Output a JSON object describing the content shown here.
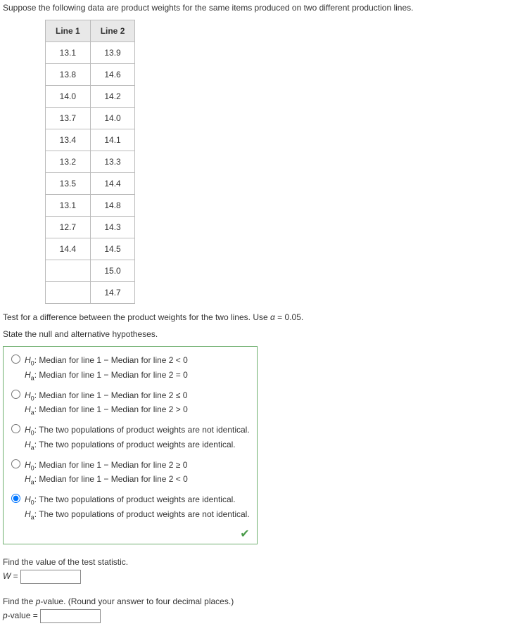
{
  "intro": "Suppose the following data are product weights for the same items produced on two different production lines.",
  "table": {
    "headers": [
      "Line 1",
      "Line 2"
    ],
    "rows": [
      [
        "13.1",
        "13.9"
      ],
      [
        "13.8",
        "14.6"
      ],
      [
        "14.0",
        "14.2"
      ],
      [
        "13.7",
        "14.0"
      ],
      [
        "13.4",
        "14.1"
      ],
      [
        "13.2",
        "13.3"
      ],
      [
        "13.5",
        "14.4"
      ],
      [
        "13.1",
        "14.8"
      ],
      [
        "12.7",
        "14.3"
      ],
      [
        "14.4",
        "14.5"
      ],
      [
        "",
        "15.0"
      ],
      [
        "",
        "14.7"
      ]
    ]
  },
  "test_prompt_1": "Test for a difference between the product weights for the two lines. Use ",
  "alpha_sym": "α",
  "alpha_val": " = 0.05.",
  "state_prompt": "State the null and alternative hypotheses.",
  "H0_label": "H",
  "H0_sub": "0",
  "Ha_label": "H",
  "Ha_sub": "a",
  "colon": ": ",
  "opt1_h0": "Median for line 1 − Median for line 2 < 0",
  "opt1_ha": "Median for line 1 − Median for line 2 = 0",
  "opt2_h0": "Median for line 1 − Median for line 2 ≤ 0",
  "opt2_ha": "Median for line 1 − Median for line 2 > 0",
  "opt3_h0": "The two populations of product weights are not identical.",
  "opt3_ha": "The two populations of product weights are identical.",
  "opt4_h0": "Median for line 1 − Median for line 2 ≥ 0",
  "opt4_ha": "Median for line 1 − Median for line 2 < 0",
  "opt5_h0": "The two populations of product weights are identical.",
  "opt5_ha": "The two populations of product weights are not identical.",
  "selected_option": 5,
  "check_icon": "✔",
  "find_stat_label": "Find the value of the test statistic.",
  "W_sym": "W",
  "equals": " = ",
  "find_p_label": "Find the ",
  "p_word": "p",
  "find_p_label2": "-value. (Round your answer to four decimal places.)",
  "p_line": "-value = "
}
